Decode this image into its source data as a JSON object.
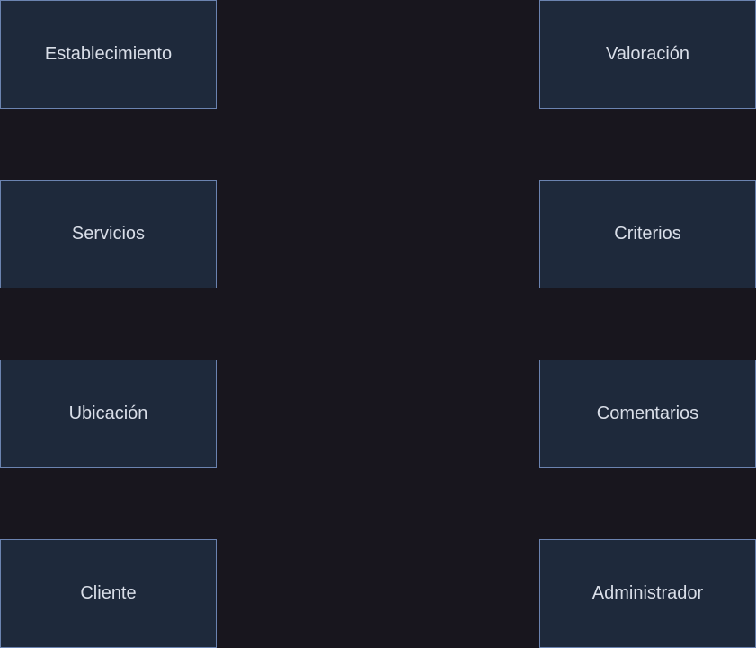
{
  "colors": {
    "background": "#18161e",
    "box_fill": "#1e293b",
    "box_border": "#6b83b0",
    "text": "#d9dee8"
  },
  "entities": {
    "left": [
      {
        "label": "Establecimiento"
      },
      {
        "label": "Servicios"
      },
      {
        "label": "Ubicación"
      },
      {
        "label": "Cliente"
      }
    ],
    "right": [
      {
        "label": "Valoración"
      },
      {
        "label": "Criterios"
      },
      {
        "label": "Comentarios"
      },
      {
        "label": "Administrador"
      }
    ]
  }
}
